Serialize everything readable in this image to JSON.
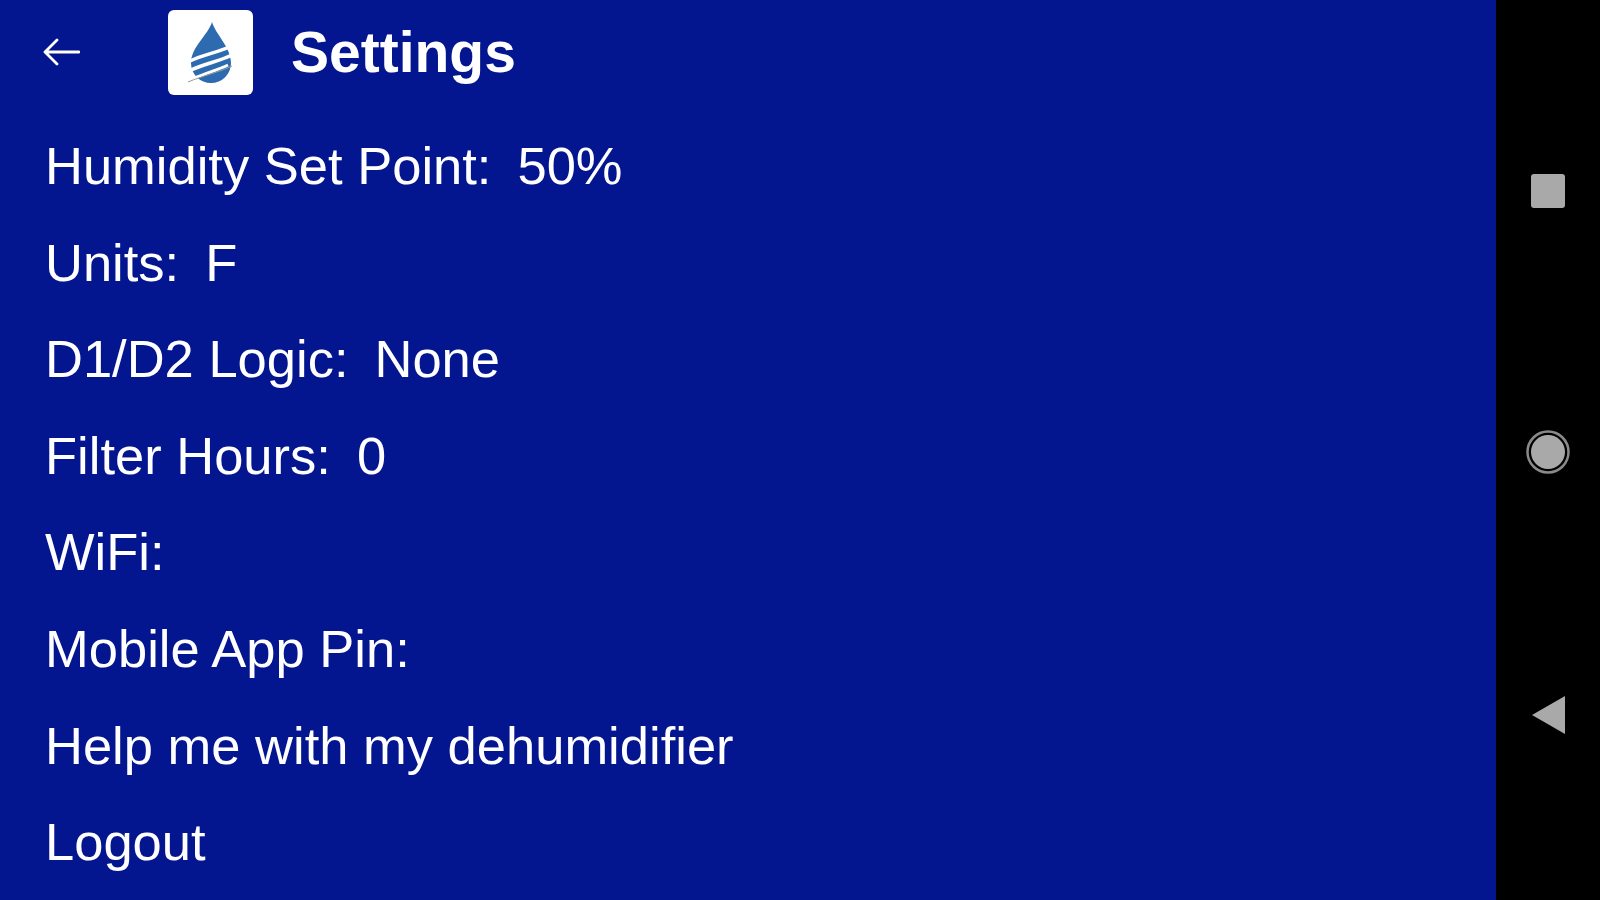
{
  "app_bar": {
    "title": "Settings"
  },
  "settings": [
    {
      "label": "Humidity Set Point:",
      "value": "50%"
    },
    {
      "label": "Units:",
      "value": "F"
    },
    {
      "label": "D1/D2 Logic:",
      "value": "None"
    },
    {
      "label": "Filter Hours:",
      "value": "0"
    },
    {
      "label": "WiFi:"
    },
    {
      "label": "Mobile App Pin:"
    },
    {
      "label": "Help me with my dehumidifier"
    },
    {
      "label": "Logout"
    }
  ]
}
